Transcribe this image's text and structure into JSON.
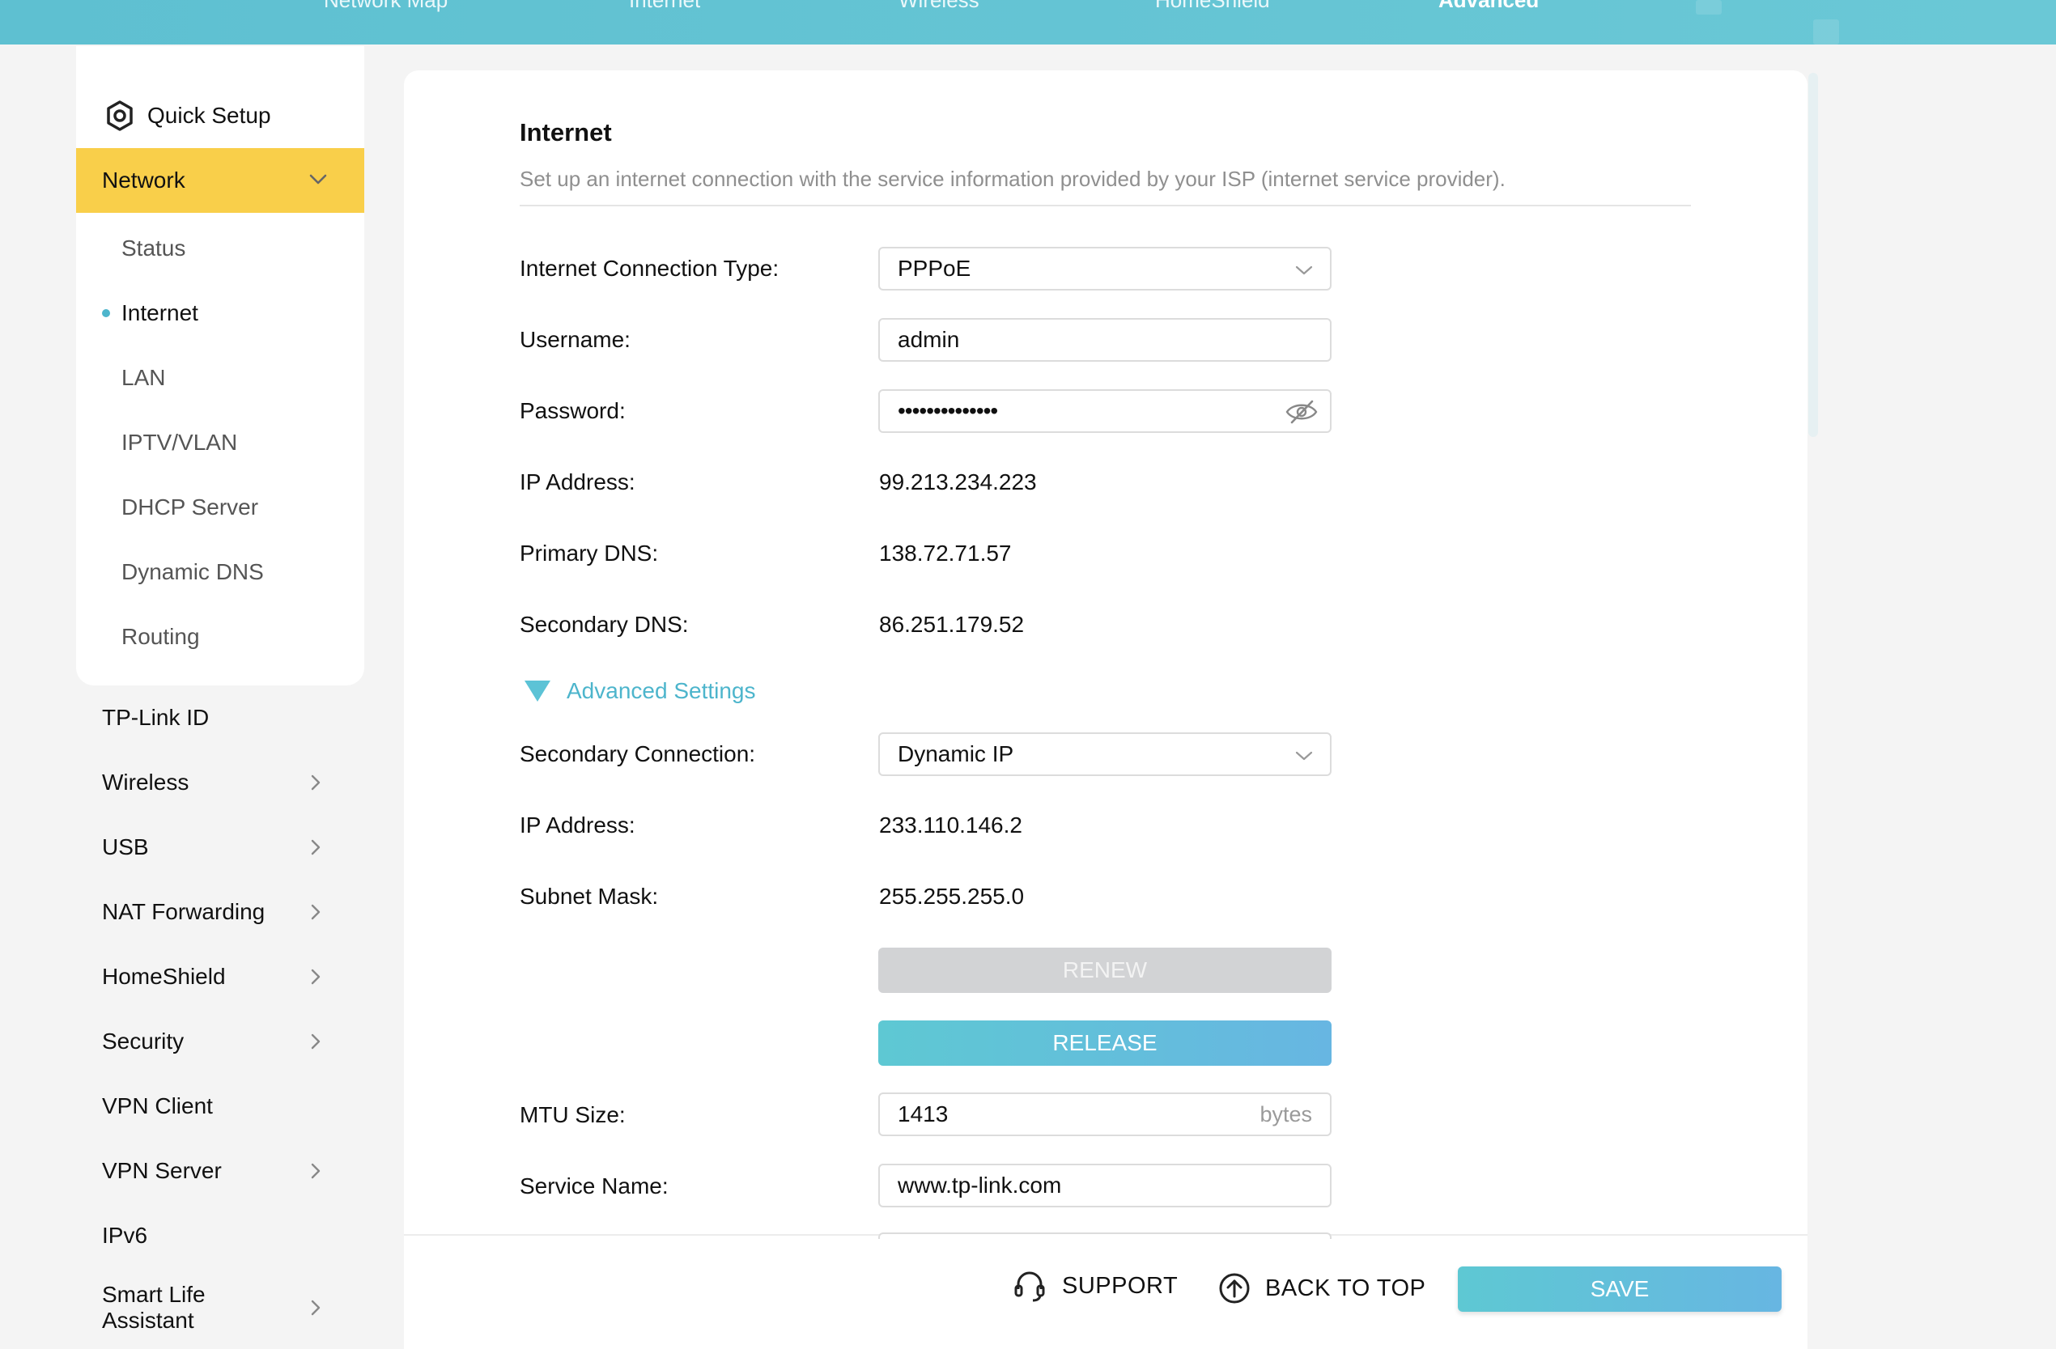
{
  "top_nav": {
    "tabs": [
      {
        "label": "Network Map"
      },
      {
        "label": "Internet"
      },
      {
        "label": "Wireless"
      },
      {
        "label": "HomeShield"
      },
      {
        "label": "Advanced"
      }
    ],
    "active_tab": "Advanced"
  },
  "sidebar": {
    "quick_setup": "Quick Setup",
    "network": {
      "label": "Network",
      "subitems": [
        {
          "label": "Status"
        },
        {
          "label": "Internet"
        },
        {
          "label": "LAN"
        },
        {
          "label": "IPTV/VLAN"
        },
        {
          "label": "DHCP Server"
        },
        {
          "label": "Dynamic DNS"
        },
        {
          "label": "Routing"
        }
      ],
      "active_subitem": "Internet"
    },
    "items": [
      {
        "label": "TP-Link ID"
      },
      {
        "label": "Wireless"
      },
      {
        "label": "USB"
      },
      {
        "label": "NAT Forwarding"
      },
      {
        "label": "HomeShield"
      },
      {
        "label": "Security"
      },
      {
        "label": "VPN Client"
      },
      {
        "label": "VPN Server"
      },
      {
        "label": "IPv6"
      },
      {
        "label": "Smart Life Assistant"
      }
    ]
  },
  "main": {
    "title": "Internet",
    "description": "Set up an internet connection with the service information provided by your ISP (internet service provider).",
    "fields": {
      "connection_type": {
        "label": "Internet Connection Type:",
        "value": "PPPoE"
      },
      "username": {
        "label": "Username:",
        "value": "admin"
      },
      "password": {
        "label": "Password:",
        "value": "••••••••••••••"
      },
      "ip_address": {
        "label": "IP Address:",
        "value": "99.213.234.223"
      },
      "primary_dns": {
        "label": "Primary DNS:",
        "value": "138.72.71.57"
      },
      "secondary_dns": {
        "label": "Secondary DNS:",
        "value": "86.251.179.52"
      }
    },
    "advanced_settings_label": "Advanced Settings",
    "advanced": {
      "secondary_connection": {
        "label": "Secondary Connection:",
        "value": "Dynamic IP"
      },
      "ip_address": {
        "label": "IP Address:",
        "value": "233.110.146.2"
      },
      "subnet_mask": {
        "label": "Subnet Mask:",
        "value": "255.255.255.0"
      },
      "renew_label": "RENEW",
      "release_label": "RELEASE",
      "mtu": {
        "label": "MTU Size:",
        "value": "1413",
        "unit": "bytes"
      },
      "service_name": {
        "label": "Service Name:",
        "value": "www.tp-link.com"
      }
    }
  },
  "footer": {
    "support_label": "SUPPORT",
    "back_to_top_label": "BACK TO TOP",
    "save_label": "SAVE"
  },
  "colors": {
    "accent_teal": "#5ec0d1",
    "active_yellow": "#f9cf4a",
    "link_teal": "#4db5cc"
  }
}
